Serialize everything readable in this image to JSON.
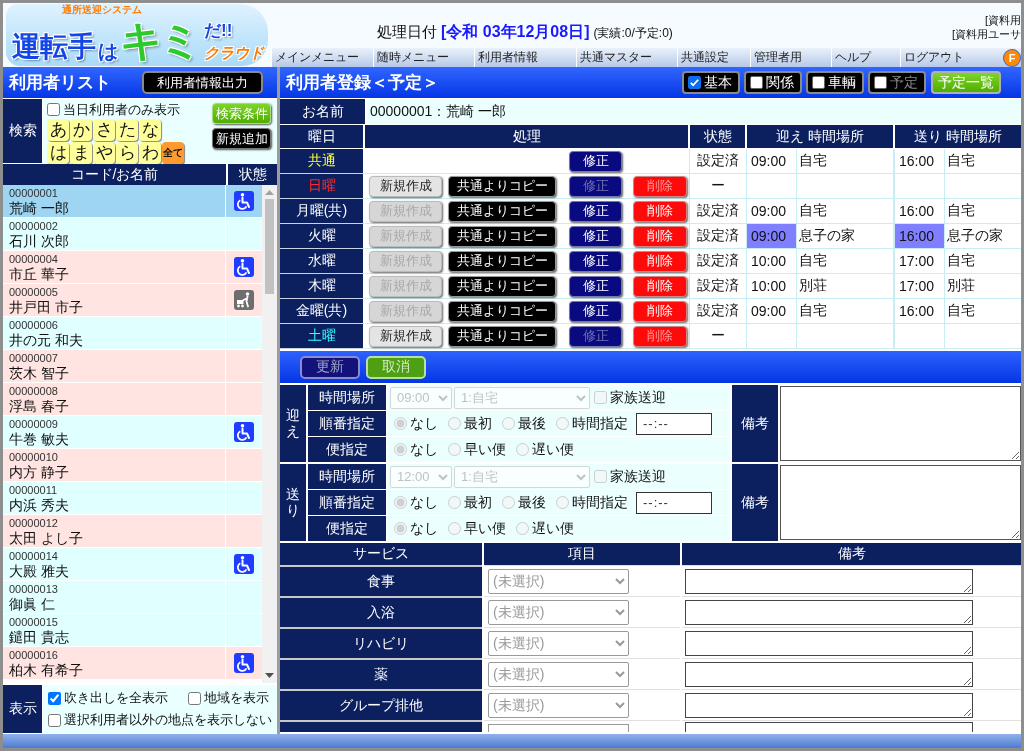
{
  "header": {
    "logo": {
      "tagline": "通所送迎システム",
      "parts": [
        {
          "text": "運転手",
          "kind": "main"
        },
        {
          "text": "は",
          "kind": "small"
        },
        {
          "text": "キミ",
          "kind": "big"
        },
        {
          "text": "だ!!",
          "kind": "exclaim"
        },
        {
          "text": "クラウド",
          "kind": "sub"
        }
      ]
    },
    "date": {
      "label": "処理日付",
      "value": "[令和 03年12月08日]",
      "counts": "(実績:0/予定:0)"
    },
    "user_info": [
      "[資料用",
      "[資料用ユーサ"
    ],
    "menu": [
      "メインメニュー",
      "随時メニュー",
      "利用者情報",
      "共通マスター",
      "共通設定",
      "管理者用",
      "ヘルプ",
      "ログアウト"
    ],
    "menu_badge": "F"
  },
  "user_list": {
    "title": "利用者リスト",
    "export_button": "利用者情報出力",
    "search": {
      "label": "検索",
      "today_only": {
        "label": "当日利用者のみ表示",
        "checked": false
      },
      "kana": [
        {
          "label": "あ",
          "kind": "kana"
        },
        {
          "label": "か",
          "kind": "kana"
        },
        {
          "label": "さ",
          "kind": "kana"
        },
        {
          "label": "た",
          "kind": "kana"
        },
        {
          "label": "な",
          "kind": "kana"
        },
        {
          "label": "は",
          "kind": "kana"
        },
        {
          "label": "ま",
          "kind": "kana"
        },
        {
          "label": "や",
          "kind": "kana"
        },
        {
          "label": "ら",
          "kind": "kana"
        },
        {
          "label": "わ",
          "kind": "kana"
        },
        {
          "label": "全て",
          "kind": "all"
        }
      ],
      "buttons": [
        {
          "label": "検索条件",
          "kind": "filter"
        },
        {
          "label": "新規追加",
          "kind": "create"
        }
      ]
    },
    "columns": [
      "コード/お名前",
      "状態"
    ],
    "rows": [
      {
        "code": "00000001",
        "name": "荒崎 一郎",
        "selected": true,
        "kind": "wheelchair"
      },
      {
        "code": "00000002",
        "name": "石川 次郎",
        "color": "#e0ffff",
        "selected": false,
        "kind": "plain"
      },
      {
        "code": "00000004",
        "name": "市丘 華子",
        "color": "#ffe4e1",
        "selected": false,
        "kind": "wheelchair"
      },
      {
        "code": "00000005",
        "name": "井戸田 市子",
        "color": "#ffe4e1",
        "selected": false,
        "kind": "walker"
      },
      {
        "code": "00000006",
        "name": "井の元 和夫",
        "color": "#e0ffff",
        "selected": false,
        "kind": "plain"
      },
      {
        "code": "00000007",
        "name": "茨木 智子",
        "color": "#ffe4e1",
        "selected": false,
        "kind": "plain"
      },
      {
        "code": "00000008",
        "name": "浮島 春子",
        "color": "#ffe4e1",
        "selected": false,
        "kind": "plain"
      },
      {
        "code": "00000009",
        "name": "牛巻 敏夫",
        "color": "#e0ffff",
        "selected": false,
        "kind": "wheelchair"
      },
      {
        "code": "00000010",
        "name": "内方 静子",
        "color": "#ffe4e1",
        "selected": false,
        "kind": "plain"
      },
      {
        "code": "00000011",
        "name": "内浜 秀夫",
        "color": "#e0ffff",
        "selected": false,
        "kind": "plain"
      },
      {
        "code": "00000012",
        "name": "太田 よし子",
        "color": "#ffe4e1",
        "selected": false,
        "kind": "plain"
      },
      {
        "code": "00000014",
        "name": "大殿 雅夫",
        "color": "#e0ffff",
        "selected": false,
        "kind": "wheelchair"
      },
      {
        "code": "00000013",
        "name": "御眞 仁",
        "color": "#e0ffff",
        "selected": false,
        "kind": "plain"
      },
      {
        "code": "00000015",
        "name": "鑓田 貴志",
        "color": "#e0ffff",
        "selected": false,
        "kind": "plain"
      },
      {
        "code": "00000016",
        "name": "柏木 有希子",
        "color": "#ffe4e1",
        "selected": false,
        "kind": "wheelchair"
      }
    ],
    "display": {
      "label": "表示",
      "options": [
        {
          "label": "吹き出しを全表示",
          "checked": true
        },
        {
          "label": "地域を表示",
          "checked": false
        },
        {
          "label": "選択利用者以外の地点を表示しない",
          "checked": false
        }
      ]
    }
  },
  "registration": {
    "title": "利用者登録＜予定＞",
    "toggles": [
      {
        "label": "基本",
        "checked": true,
        "disabled": false
      },
      {
        "label": "関係",
        "checked": false,
        "disabled": false
      },
      {
        "label": "車輌",
        "checked": false,
        "disabled": false
      },
      {
        "label": "予定",
        "checked": false,
        "disabled": true
      }
    ],
    "schedule_list_button": "予定一覧",
    "name_label": "お名前",
    "name_value": "00000001：荒崎 一郎",
    "columns": [
      "曜日",
      "処理",
      "状態",
      "迎え 時間場所",
      "送り 時間場所"
    ],
    "days": [
      {
        "day": "共通",
        "kind": "common",
        "actions": [
          {
            "label": "修正",
            "kind": "edit",
            "disabled": false
          }
        ],
        "status": "設定済",
        "pickup_time": "09:00",
        "pickup_place": "自宅",
        "dropoff_time": "16:00",
        "dropoff_place": "自宅",
        "highlighted": false
      },
      {
        "day": "日曜",
        "kind": "sunday",
        "actions": [
          {
            "label": "新規作成",
            "kind": "create",
            "disabled": false
          },
          {
            "label": "共通よりコピー",
            "kind": "copy",
            "disabled": false
          },
          {
            "label": "修正",
            "kind": "edit",
            "disabled": true
          },
          {
            "label": "削除",
            "kind": "delete",
            "disabled": true
          }
        ],
        "status": "ー",
        "highlighted": false
      },
      {
        "day": "月曜(共)",
        "kind": "weekday",
        "actions": [
          {
            "label": "新規作成",
            "kind": "create",
            "disabled": true
          },
          {
            "label": "共通よりコピー",
            "kind": "copy",
            "disabled": false
          },
          {
            "label": "修正",
            "kind": "edit",
            "disabled": false
          },
          {
            "label": "削除",
            "kind": "delete",
            "disabled": false
          }
        ],
        "status": "設定済",
        "pickup_time": "09:00",
        "pickup_place": "自宅",
        "dropoff_time": "16:00",
        "dropoff_place": "自宅",
        "highlighted": false
      },
      {
        "day": "火曜",
        "kind": "weekday",
        "actions": [
          {
            "label": "新規作成",
            "kind": "create",
            "disabled": true
          },
          {
            "label": "共通よりコピー",
            "kind": "copy",
            "disabled": false
          },
          {
            "label": "修正",
            "kind": "edit",
            "disabled": false
          },
          {
            "label": "削除",
            "kind": "delete",
            "disabled": false
          }
        ],
        "status": "設定済",
        "pickup_time": "09:00",
        "pickup_place": "息子の家",
        "dropoff_time": "16:00",
        "dropoff_place": "息子の家",
        "highlighted": true
      },
      {
        "day": "水曜",
        "kind": "weekday",
        "actions": [
          {
            "label": "新規作成",
            "kind": "create",
            "disabled": true
          },
          {
            "label": "共通よりコピー",
            "kind": "copy",
            "disabled": false
          },
          {
            "label": "修正",
            "kind": "edit",
            "disabled": false
          },
          {
            "label": "削除",
            "kind": "delete",
            "disabled": false
          }
        ],
        "status": "設定済",
        "pickup_time": "10:00",
        "pickup_place": "自宅",
        "dropoff_time": "17:00",
        "dropoff_place": "自宅",
        "highlighted": false
      },
      {
        "day": "木曜",
        "kind": "weekday",
        "actions": [
          {
            "label": "新規作成",
            "kind": "create",
            "disabled": true
          },
          {
            "label": "共通よりコピー",
            "kind": "copy",
            "disabled": false
          },
          {
            "label": "修正",
            "kind": "edit",
            "disabled": false
          },
          {
            "label": "削除",
            "kind": "delete",
            "disabled": false
          }
        ],
        "status": "設定済",
        "pickup_time": "10:00",
        "pickup_place": "別荘",
        "dropoff_time": "17:00",
        "dropoff_place": "別荘",
        "highlighted": false
      },
      {
        "day": "金曜(共)",
        "kind": "weekday",
        "actions": [
          {
            "label": "新規作成",
            "kind": "create",
            "disabled": true
          },
          {
            "label": "共通よりコピー",
            "kind": "copy",
            "disabled": false
          },
          {
            "label": "修正",
            "kind": "edit",
            "disabled": false
          },
          {
            "label": "削除",
            "kind": "delete",
            "disabled": false
          }
        ],
        "status": "設定済",
        "pickup_time": "09:00",
        "pickup_place": "自宅",
        "dropoff_time": "16:00",
        "dropoff_place": "自宅",
        "highlighted": false
      },
      {
        "day": "土曜",
        "kind": "saturday",
        "actions": [
          {
            "label": "新規作成",
            "kind": "create",
            "disabled": false
          },
          {
            "label": "共通よりコピー",
            "kind": "copy",
            "disabled": false
          },
          {
            "label": "修正",
            "kind": "edit",
            "disabled": true
          },
          {
            "label": "削除",
            "kind": "delete",
            "disabled": true
          }
        ],
        "status": "ー",
        "highlighted": false
      }
    ],
    "buttons": [
      {
        "label": "更新",
        "kind": "update",
        "disabled": true
      },
      {
        "label": "取消",
        "kind": "cancel",
        "disabled": true
      }
    ],
    "transport": [
      {
        "label": "迎え",
        "disabled": true,
        "place_label": "時間場所",
        "time": "09:00",
        "place": "1:自宅",
        "family": {
          "label": "家族送迎",
          "checked": false
        },
        "order_label": "順番指定",
        "order_options": [
          {
            "label": "なし",
            "selected": true
          },
          {
            "label": "最初",
            "selected": false
          },
          {
            "label": "最後",
            "selected": false
          },
          {
            "label": "時間指定",
            "selected": false
          }
        ],
        "order_time": {
          "placeholder": "--:--"
        },
        "trip_label": "便指定",
        "trip_options": [
          {
            "label": "なし",
            "selected": true
          },
          {
            "label": "早い便",
            "selected": false
          },
          {
            "label": "遅い便",
            "selected": false
          }
        ],
        "note_label": "備考"
      },
      {
        "label": "送り",
        "disabled": true,
        "place_label": "時間場所",
        "time": "12:00",
        "place": "1:自宅",
        "family": {
          "label": "家族送迎",
          "checked": false
        },
        "order_label": "順番指定",
        "order_options": [
          {
            "label": "なし",
            "selected": true
          },
          {
            "label": "最初",
            "selected": false
          },
          {
            "label": "最後",
            "selected": false
          },
          {
            "label": "時間指定",
            "selected": false
          }
        ],
        "order_time": {
          "placeholder": "--:--"
        },
        "trip_label": "便指定",
        "trip_options": [
          {
            "label": "なし",
            "selected": true
          },
          {
            "label": "早い便",
            "selected": false
          },
          {
            "label": "遅い便",
            "selected": false
          }
        ],
        "note_label": "備考"
      }
    ],
    "services": {
      "columns": [
        "サービス",
        "項目",
        "備考"
      ],
      "rows": [
        {
          "name": "食事",
          "placeholder": "(未選択)"
        },
        {
          "name": "入浴",
          "placeholder": "(未選択)"
        },
        {
          "name": "リハビリ",
          "placeholder": "(未選択)"
        },
        {
          "name": "薬",
          "placeholder": "(未選択)"
        },
        {
          "name": "グループ排他",
          "placeholder": "(未選択)"
        }
      ]
    }
  }
}
